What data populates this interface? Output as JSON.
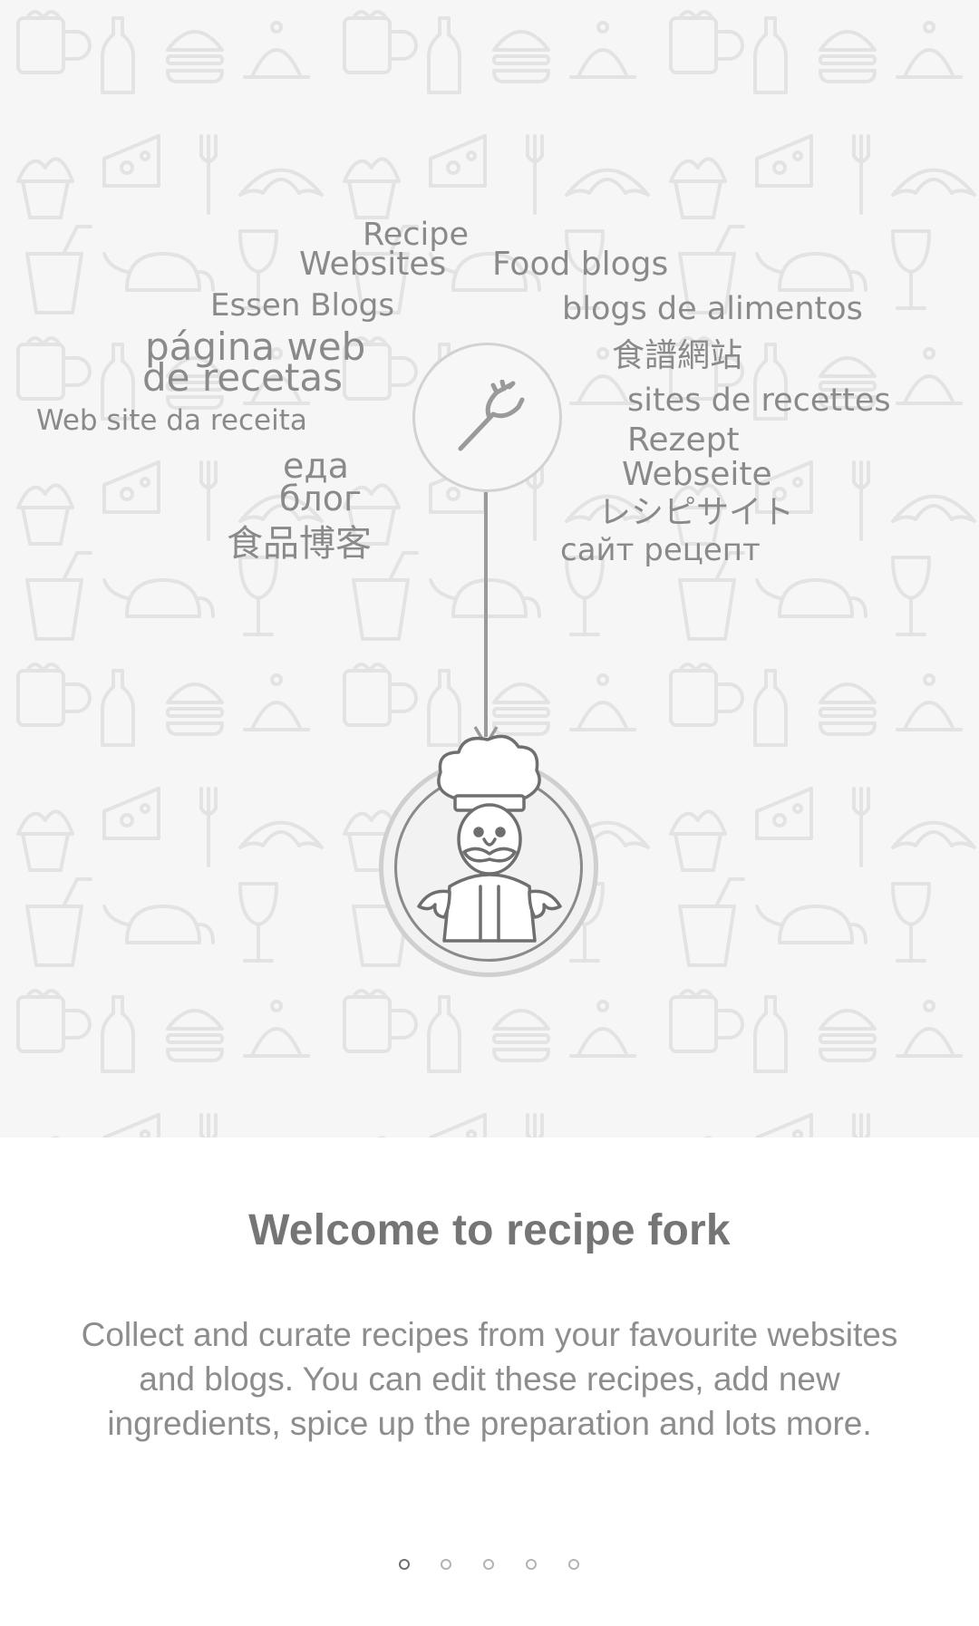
{
  "hero": {
    "words": [
      "Recipe",
      "Websites",
      "Food blogs",
      "Essen Blogs",
      "blogs de alimentos",
      "página web",
      "de recetas",
      "食譜網站",
      "Web site da receita",
      "sites de recettes",
      "еда",
      "блог",
      "Rezept",
      "Webseite",
      "食品博客",
      "レシピサイト",
      "сайт рецепт"
    ]
  },
  "onboarding": {
    "title": "Welcome to recipe fork",
    "description": "Collect and curate recipes from your favourite websites and blogs. You can edit these recipes, add new ingredients, spice up the preparation and lots more."
  },
  "pager": {
    "total": 5,
    "current": 1
  },
  "icons": {
    "center": "fork-icon",
    "mascot": "chef-mascot-icon",
    "background": "food-doodle-pattern"
  }
}
